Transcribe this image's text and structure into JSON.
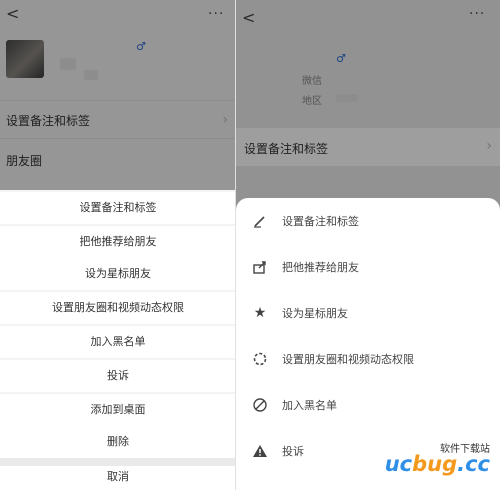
{
  "left": {
    "nav": {
      "back": "<",
      "more": "···"
    },
    "rows": [
      "设置备注和标签",
      "朋友圈"
    ],
    "sheet_items": [
      "设置备注和标签",
      "把他推荐给朋友",
      "设为星标朋友",
      "设置朋友圈和视频动态权限",
      "加入黑名单",
      "投诉",
      "添加到桌面",
      "删除"
    ],
    "cancel": "取消"
  },
  "right": {
    "nav": {
      "back": "<",
      "more": "···"
    },
    "info": {
      "wechat_id": "微信",
      "region": "地区"
    },
    "row": "设置备注和标签",
    "sheet_items": [
      {
        "label": "设置备注和标签",
        "icon": "pencil-icon"
      },
      {
        "label": "把他推荐给朋友",
        "icon": "share-icon"
      },
      {
        "label": "设为星标朋友",
        "icon": "star-icon"
      },
      {
        "label": "设置朋友圈和视频动态权限",
        "icon": "moments-icon"
      },
      {
        "label": "加入黑名单",
        "icon": "block-icon"
      },
      {
        "label": "投诉",
        "icon": "warning-icon"
      }
    ]
  },
  "watermark": {
    "top": "软件下载站",
    "logo_a": "uc",
    "logo_b": "bug",
    "logo_c": ".cc"
  },
  "colors": {
    "overlay": "rgba(0,0,0,0.38)",
    "logo_blue": "#2f8fe6",
    "logo_orange": "#f39a1e"
  }
}
